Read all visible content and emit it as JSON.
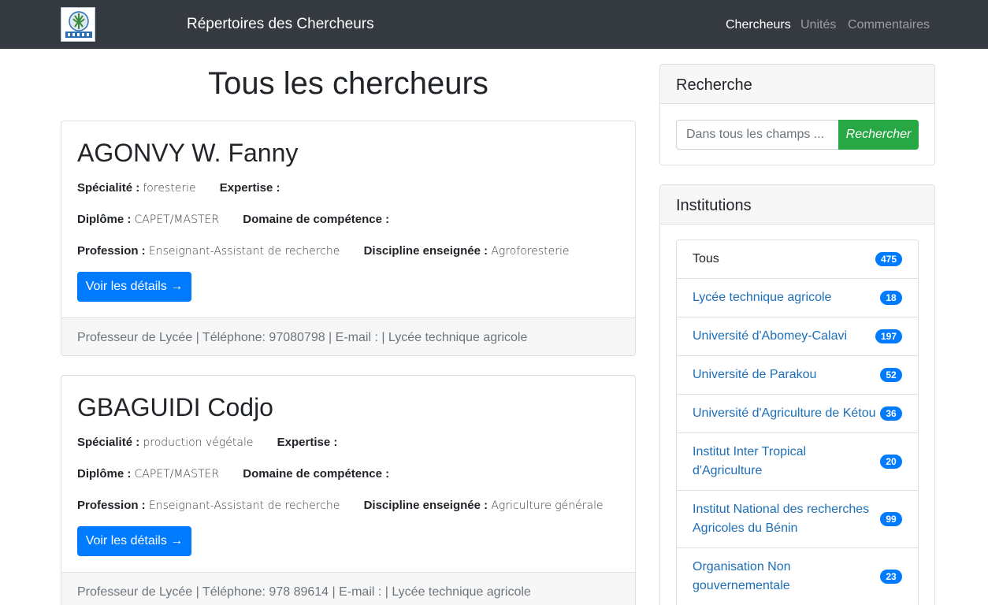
{
  "navbar": {
    "brand": "Répertoires des Chercheurs",
    "links": [
      "Chercheurs",
      "Unités",
      "Commentaires"
    ]
  },
  "main": {
    "title": "Tous les chercheurs",
    "researchers": [
      {
        "name": "AGONVY W. Fanny",
        "labels": {
          "specialite": "Spécialité :",
          "expertise": "Expertise :",
          "diplome": "Diplôme :",
          "domaine": "Domaine de compétence :",
          "profession": "Profession :",
          "discipline": "Discipline enseignée :"
        },
        "specialite": "foresterie",
        "diplome": "CAPET/MASTER",
        "profession": "Enseignant-Assistant de recherche",
        "discipline": "Agroforesterie",
        "button": "Voir les détails →",
        "footer": "Professeur de Lycée | Téléphone: 97080798 | E-mail :      |     Lycée technique agricole"
      },
      {
        "name": "GBAGUIDI Codjo",
        "labels": {
          "specialite": "Spécialité :",
          "expertise": "Expertise :",
          "diplome": "Diplôme :",
          "domaine": "Domaine de compétence :",
          "profession": "Profession :",
          "discipline": "Discipline enseignée :"
        },
        "specialite": "production végétale",
        "diplome": "CAPET/MASTER",
        "profession": "Enseignant-Assistant de recherche",
        "discipline": "Agriculture générale",
        "button": "Voir les détails →",
        "footer": "Professeur de Lycée | Téléphone: 978 89614 | E-mail :      |     Lycée technique agricole"
      }
    ]
  },
  "sidebar": {
    "search": {
      "title": "Recherche",
      "placeholder": "Dans tous les champs ...",
      "button": "Rechercher"
    },
    "institutions": {
      "title": "Institutions",
      "items": [
        {
          "label": "Tous",
          "count": "475"
        },
        {
          "label": "Lycée technique agricole",
          "count": "18"
        },
        {
          "label": "Université d'Abomey-Calavi",
          "count": "197"
        },
        {
          "label": "Université de Parakou",
          "count": "52"
        },
        {
          "label": "Université d'Agriculture de Kétou",
          "count": "36"
        },
        {
          "label": "Institut Inter Tropical d'Agriculture",
          "count": "20"
        },
        {
          "label": "Institut National des recherches Agricoles du Bénin",
          "count": "99"
        },
        {
          "label": "Organisation Non gouvernementale",
          "count": "23"
        }
      ]
    }
  },
  "colors": {
    "navbar": "#343a40",
    "primary": "#007bff",
    "success": "#28a745",
    "link": "#1d6fb8"
  }
}
